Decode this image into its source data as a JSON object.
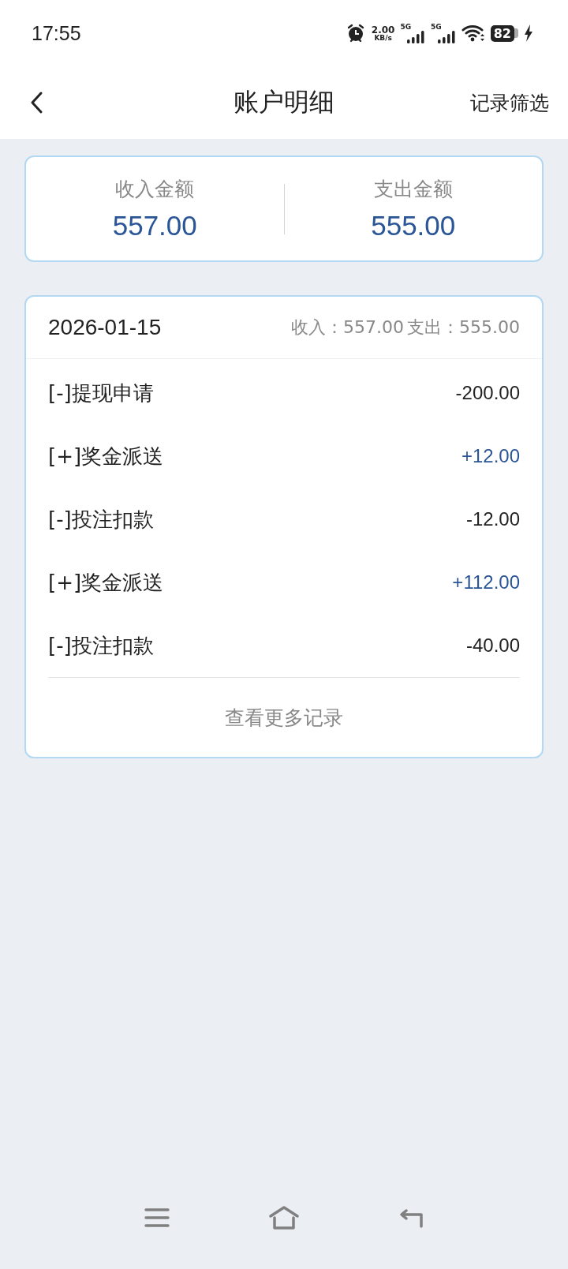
{
  "status_bar": {
    "time": "17:55",
    "net_speed": "2.00",
    "net_unit": "KB/s",
    "signal_1": "5G",
    "signal_2": "5G",
    "battery": "82"
  },
  "header": {
    "title": "账户明细",
    "action": "记录筛选"
  },
  "summary": [
    {
      "label": "收入金额",
      "value": "557.00"
    },
    {
      "label": "支出金额",
      "value": "555.00"
    }
  ],
  "record_group": {
    "date": "2026-01-15",
    "income": "收入：557.00",
    "expense": "支出：555.00",
    "rows": [
      {
        "kind": "expense",
        "label": "[-]提现申请",
        "amount": "-200.00"
      },
      {
        "kind": "income",
        "label": "[+]奖金派送",
        "amount": "+12.00"
      },
      {
        "kind": "expense",
        "label": "[-]投注扣款",
        "amount": "-12.00"
      },
      {
        "kind": "income",
        "label": "[+]奖金派送",
        "amount": "+112.00"
      },
      {
        "kind": "expense",
        "label": "[-]投注扣款",
        "amount": "-40.00"
      }
    ],
    "more": "查看更多记录"
  }
}
